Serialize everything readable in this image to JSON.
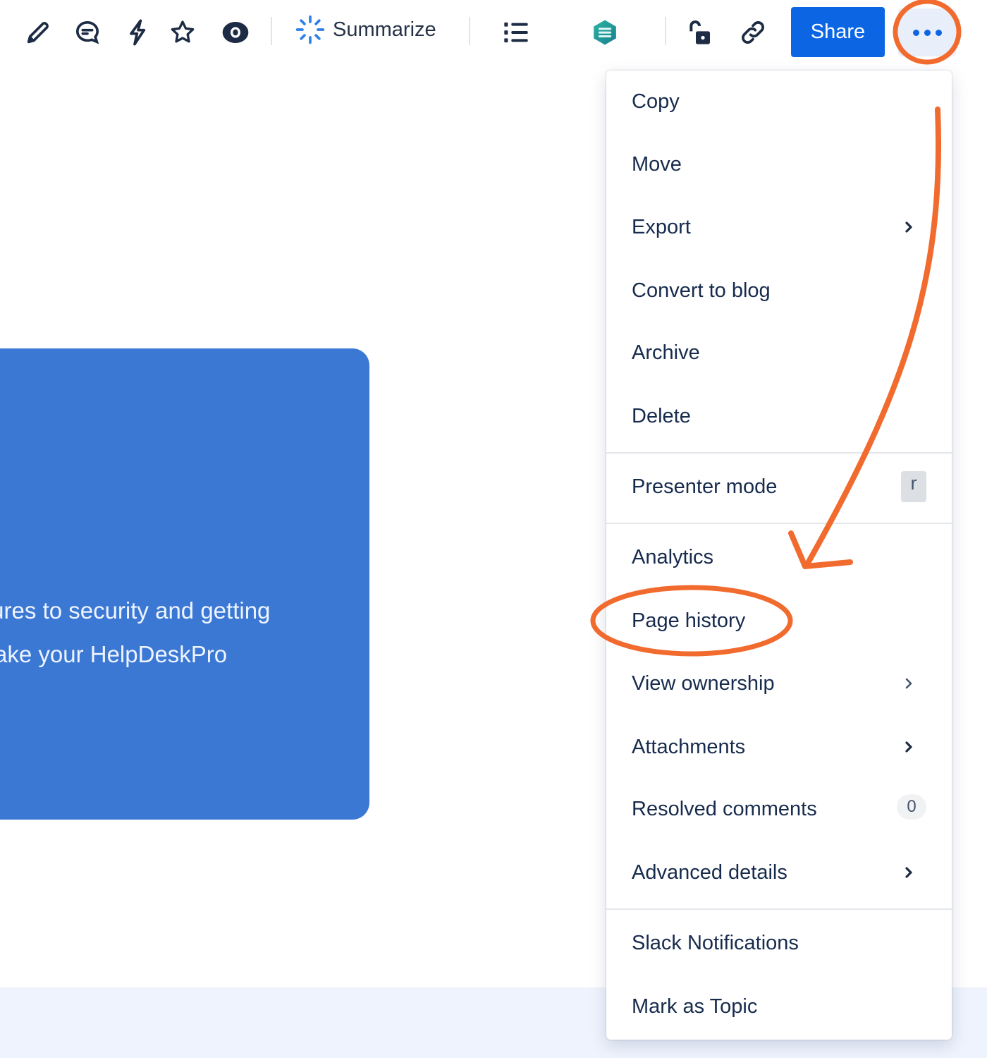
{
  "toolbar": {
    "icons": [
      {
        "name": "edit",
        "icon": "pencil-icon"
      },
      {
        "name": "comment",
        "icon": "comment-icon"
      },
      {
        "name": "automation",
        "icon": "lightning-icon"
      },
      {
        "name": "star",
        "icon": "star-icon"
      },
      {
        "name": "watch",
        "icon": "eye-icon"
      }
    ],
    "summarize_label": "Summarize",
    "table_of_contents_icon": "numbered-list-icon",
    "app_icon": "hexagon-app-icon",
    "restrictions_icon": "unlock-icon",
    "copy_link_icon": "link-icon",
    "share_label": "Share",
    "more_actions_icon": "more-horizontal-icon"
  },
  "content": {
    "hero_line_1": "tures to security and getting",
    "hero_line_2": "ake your HelpDeskPro",
    "hero_color": "#3b78d3"
  },
  "menu": {
    "items": [
      {
        "label": "Copy"
      },
      {
        "label": "Move"
      },
      {
        "label": "Export",
        "submenu": true
      },
      {
        "label": "Convert to blog"
      },
      {
        "label": "Archive"
      },
      {
        "label": "Delete"
      },
      {
        "label": "Presenter mode",
        "shortcut": "r"
      },
      {
        "label": "Analytics"
      },
      {
        "label": "Page history",
        "highlighted": true
      },
      {
        "label": "View ownership",
        "submenu": true
      },
      {
        "label": "Attachments",
        "submenu": true
      },
      {
        "label": "Resolved comments",
        "count": "0"
      },
      {
        "label": "Advanced details",
        "submenu": true
      },
      {
        "label": "Slack Notifications"
      },
      {
        "label": "Mark as Topic"
      }
    ]
  },
  "colors": {
    "primary": "#0c66e4",
    "annotation": "#f26b2e",
    "text": "#172b4d"
  }
}
